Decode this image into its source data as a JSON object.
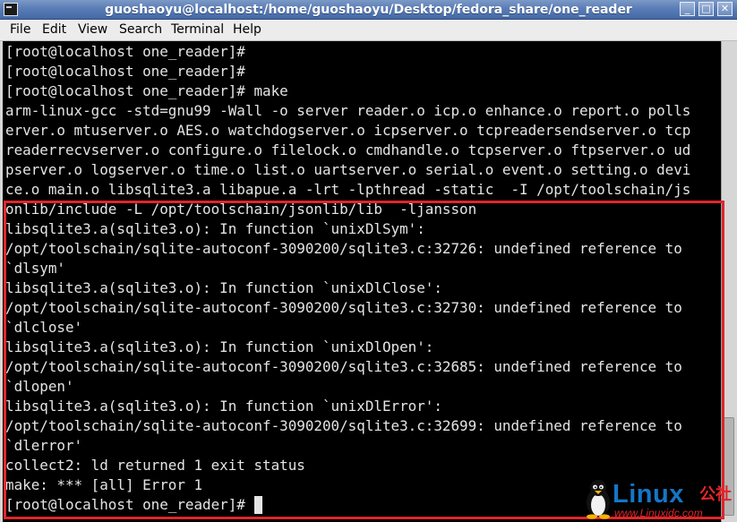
{
  "window": {
    "title": "guoshaoyu@localhost:/home/guoshaoyu/Desktop/fedora_share/one_reader",
    "minimize_glyph": "_",
    "maximize_glyph": "□",
    "close_glyph": "✕",
    "app_icon": "terminal-icon"
  },
  "menubar": {
    "items": [
      {
        "label": "File"
      },
      {
        "label": "Edit"
      },
      {
        "label": "View"
      },
      {
        "label": "Search"
      },
      {
        "label": "Terminal"
      },
      {
        "label": "Help"
      }
    ]
  },
  "terminal": {
    "lines": [
      "[root@localhost one_reader]#",
      "[root@localhost one_reader]#",
      "[root@localhost one_reader]# make",
      "arm-linux-gcc -std=gnu99 -Wall -o server reader.o icp.o enhance.o report.o polls",
      "erver.o mtuserver.o AES.o watchdogserver.o icpserver.o tcpreadersendserver.o tcp",
      "readerrecvserver.o configure.o filelock.o cmdhandle.o tcpserver.o ftpserver.o ud",
      "pserver.o logserver.o time.o list.o uartserver.o serial.o event.o setting.o devi",
      "ce.o main.o libsqlite3.a libapue.a -lrt -lpthread -static  -I /opt/toolschain/js",
      "onlib/include -L /opt/toolschain/jsonlib/lib  -ljansson",
      "libsqlite3.a(sqlite3.o): In function `unixDlSym':",
      "/opt/toolschain/sqlite-autoconf-3090200/sqlite3.c:32726: undefined reference to",
      "`dlsym'",
      "libsqlite3.a(sqlite3.o): In function `unixDlClose':",
      "/opt/toolschain/sqlite-autoconf-3090200/sqlite3.c:32730: undefined reference to",
      "`dlclose'",
      "libsqlite3.a(sqlite3.o): In function `unixDlOpen':",
      "/opt/toolschain/sqlite-autoconf-3090200/sqlite3.c:32685: undefined reference to",
      "`dlopen'",
      "libsqlite3.a(sqlite3.o): In function `unixDlError':",
      "/opt/toolschain/sqlite-autoconf-3090200/sqlite3.c:32699: undefined reference to",
      "`dlerror'",
      "collect2: ld returned 1 exit status",
      "make: *** [all] Error 1"
    ],
    "prompt": "[root@localhost one_reader]# "
  },
  "watermark": {
    "brand": "Linux",
    "brand_cn": "公社",
    "url": "www.Linuxidc.com"
  },
  "colors": {
    "terminal_bg": "#000000",
    "terminal_fg": "#e4e4e4",
    "highlight": "#e0262a",
    "titlebar": "#5a7db6"
  }
}
